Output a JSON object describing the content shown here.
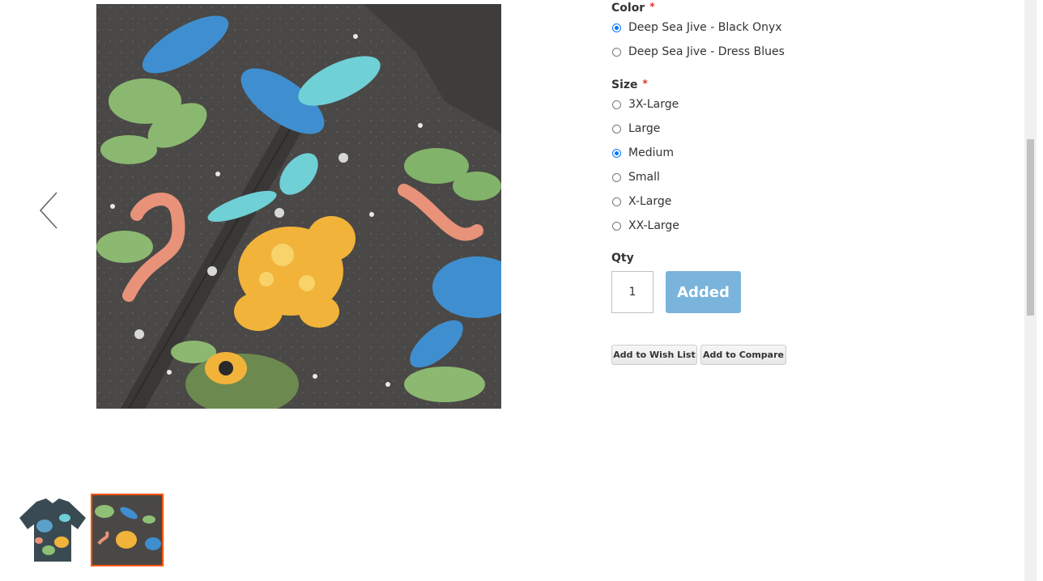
{
  "product_options": {
    "color": {
      "label": "Color",
      "required_mark": "*",
      "options": [
        {
          "label": "Deep Sea Jive - Black Onyx",
          "selected": true
        },
        {
          "label": "Deep Sea Jive - Dress Blues",
          "selected": false
        }
      ]
    },
    "size": {
      "label": "Size",
      "required_mark": "*",
      "options": [
        {
          "label": "3X-Large",
          "selected": false
        },
        {
          "label": "Large",
          "selected": false
        },
        {
          "label": "Medium",
          "selected": true
        },
        {
          "label": "Small",
          "selected": false
        },
        {
          "label": "X-Large",
          "selected": false
        },
        {
          "label": "XX-Large",
          "selected": false
        }
      ]
    },
    "qty": {
      "label": "Qty",
      "value": "1"
    },
    "add_button_label": "Added",
    "wishlist_label": "Add to Wish List",
    "compare_label": "Add to Compare"
  },
  "gallery": {
    "main_image": "hawaiian-shirt-closeup-print",
    "thumbnails": [
      "shirt-full-view",
      "shirt-closeup"
    ],
    "active_thumbnail_index": 1,
    "prev_icon": "chevron-left-icon"
  },
  "colors": {
    "accent_button": "#7ab3db",
    "required": "#e02b27",
    "active_thumb_border": "#ff5501"
  }
}
